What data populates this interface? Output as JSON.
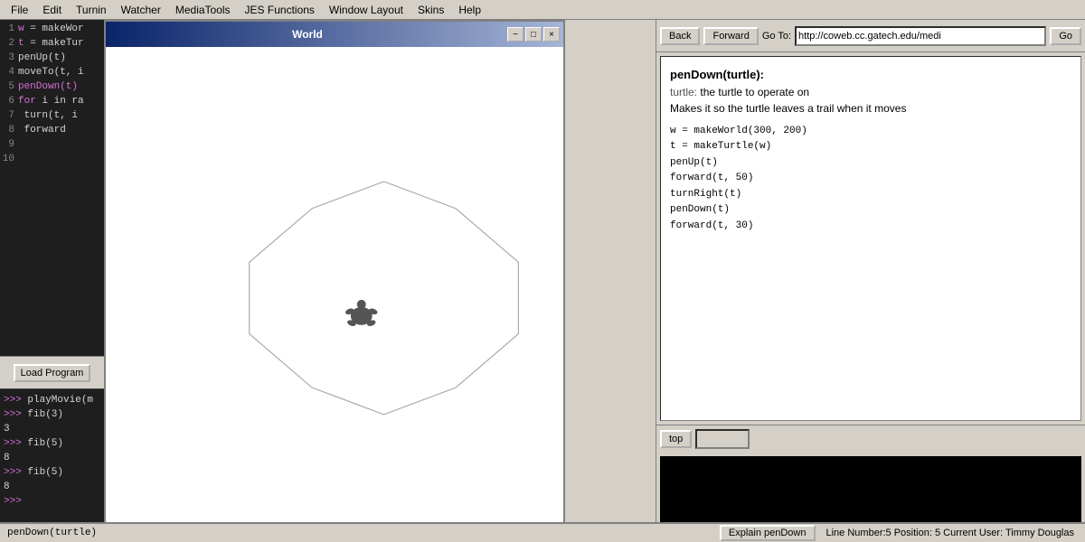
{
  "menubar": {
    "items": [
      "File",
      "Edit",
      "Turnin",
      "Watcher",
      "MediaTools",
      "JES Functions",
      "Window Layout",
      "Skins",
      "Help"
    ]
  },
  "world_window": {
    "title": "World",
    "min_label": "−",
    "max_label": "□",
    "close_label": "×"
  },
  "left_panel": {
    "code_lines": [
      {
        "num": "1",
        "text": "w = makeWor"
      },
      {
        "num": "2",
        "text": "t = makeTur"
      },
      {
        "num": "3",
        "text": "penUp(t)"
      },
      {
        "num": "4",
        "text": "moveTo(t, i"
      },
      {
        "num": "5",
        "text": "penDown(t)"
      },
      {
        "num": "6",
        "text": "for i in ra"
      },
      {
        "num": "7",
        "text": "  turn(t, i"
      },
      {
        "num": "8",
        "text": "  forward"
      },
      {
        "num": "9",
        "text": ""
      },
      {
        "num": "10",
        "text": ""
      }
    ],
    "load_button": "Load Program",
    "console_lines": [
      ">>> playMovie(m",
      ">>> fib(3)",
      "3",
      ">>> fib(5)",
      "8",
      ">>> fib(5)",
      "8",
      ">>> "
    ]
  },
  "browser": {
    "back_label": "Back",
    "forward_label": "Forward",
    "go_to_label": "Go To:",
    "url_value": "http://coweb.cc.gatech.edu/medi",
    "go_label": "Go"
  },
  "documentation": {
    "function_name": "penDown(turtle):",
    "param_label": "turtle:",
    "param_desc": "the turtle to operate on",
    "description": "Makes it so the turtle leaves a trail when it moves",
    "code_example": "w = makeWorld(300, 200)\nt = makeTurtle(w)\npenUp(t)\nforward(t, 50)\nturnRight(t)\npenDown(t)\nforward(t, 30)"
  },
  "controls": {
    "stop_label": "top",
    "slider_value": ""
  },
  "statusbar": {
    "status_text": "penDown(turtle)",
    "explain_label": "Explain penDown",
    "info_text": "Line Number:5  Position: 5    Current User: Timmy Douglas"
  }
}
